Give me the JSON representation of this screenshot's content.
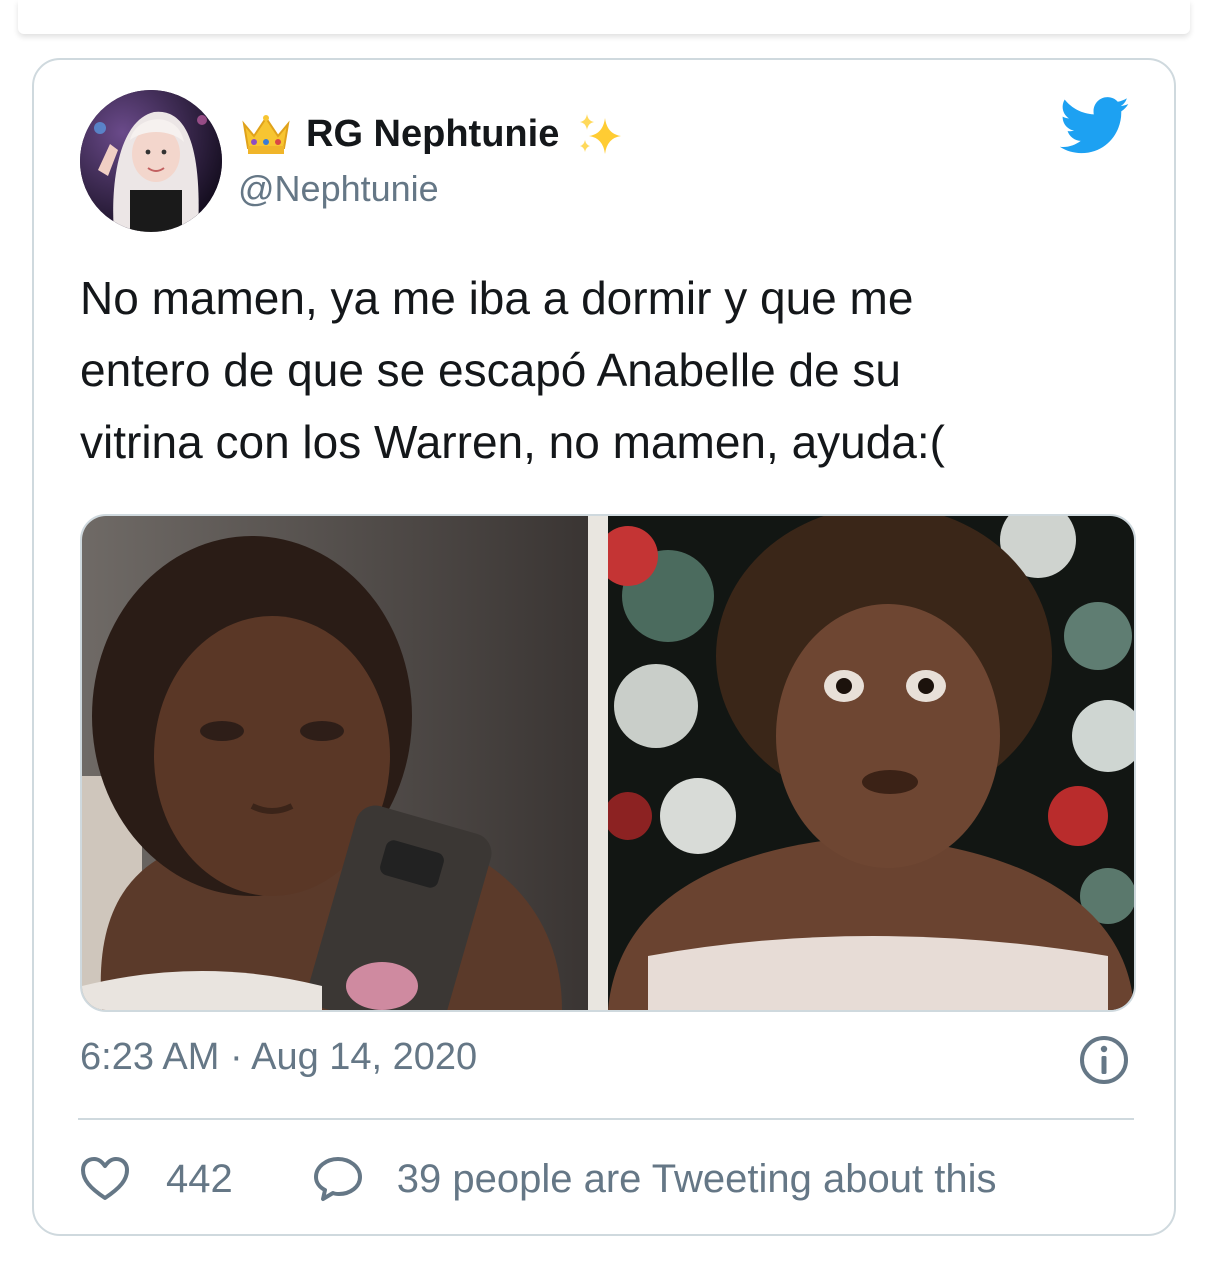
{
  "user": {
    "display_name": "RG Nephtunie",
    "handle": "@Nephtunie",
    "name_emoji_left": "crown-emoji",
    "name_emoji_right": "sparkles-emoji"
  },
  "tweet": {
    "text": "No mamen, ya me iba a dormir y que me\nentero de que se escapó Anabelle de su\nvitrina con los Warren, no mamen, ayuda:(",
    "timestamp": "6:23 AM · Aug 14, 2020"
  },
  "engagement": {
    "likes": "442",
    "tweeting_text": "39 people are Tweeting about this"
  },
  "icons": {
    "brand": "twitter-bird-icon",
    "info": "info-icon",
    "like": "heart-icon",
    "reply": "speech-bubble-icon"
  },
  "colors": {
    "twitter_blue": "#1da1f2",
    "text_primary": "#14171a",
    "text_secondary": "#657786",
    "border": "#cfd9de"
  }
}
